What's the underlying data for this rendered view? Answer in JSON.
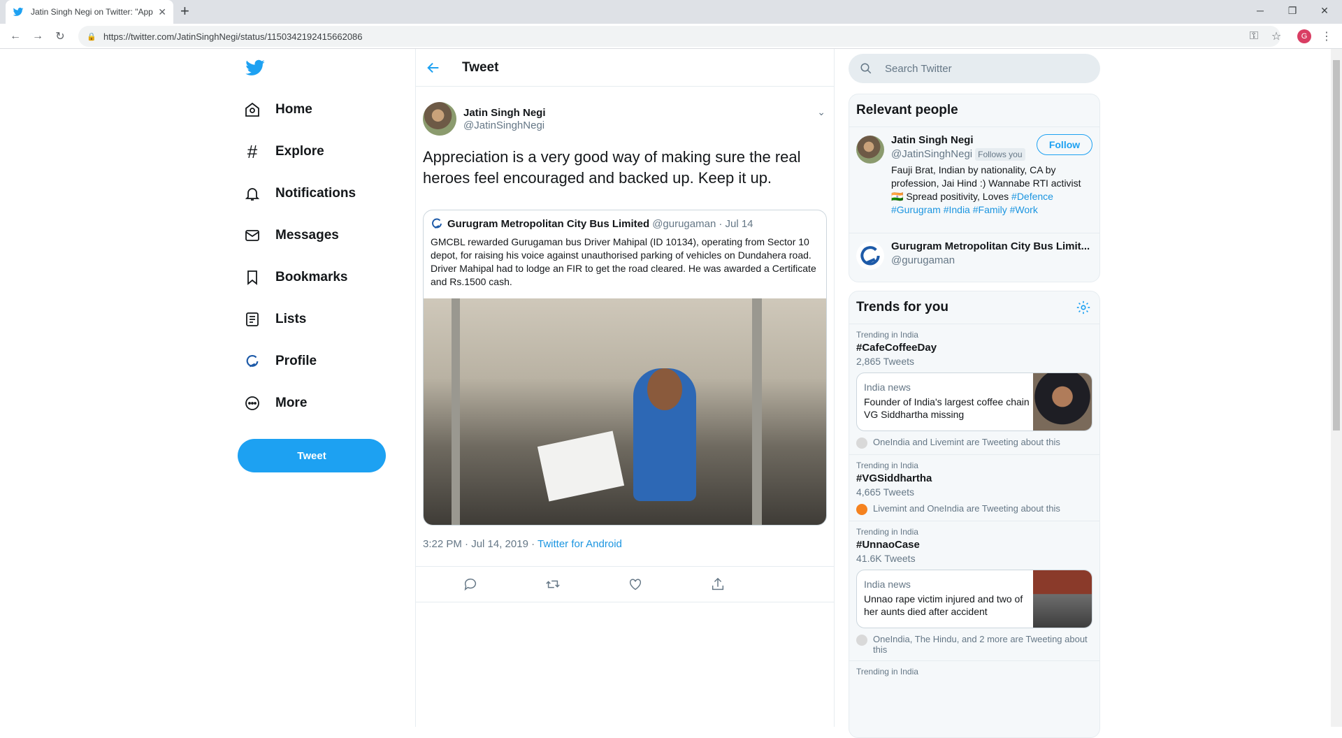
{
  "browser": {
    "tab_title": "Jatin Singh Negi on Twitter: \"App",
    "url": "https://twitter.com/JatinSinghNegi/status/1150342192415662086",
    "profile_initial": "G"
  },
  "sidebar": {
    "items": [
      {
        "label": "Home"
      },
      {
        "label": "Explore"
      },
      {
        "label": "Notifications"
      },
      {
        "label": "Messages"
      },
      {
        "label": "Bookmarks"
      },
      {
        "label": "Lists"
      },
      {
        "label": "Profile"
      },
      {
        "label": "More"
      }
    ],
    "tweet_button": "Tweet"
  },
  "main": {
    "header_title": "Tweet",
    "author_name": "Jatin Singh Negi",
    "author_handle": "@JatinSinghNegi",
    "text": "Appreciation is a very good way of making sure the real heroes feel encouraged and backed up. Keep it up.",
    "quote": {
      "name": "Gurugram Metropolitan City Bus Limited",
      "handle": "@gurugaman",
      "date": "· Jul 14",
      "text": "GMCBL rewarded Gurugaman bus Driver Mahipal (ID 10134), operating from Sector 10 depot, for raising his voice against unauthorised parking of vehicles on Dundahera road. Driver Mahipal had to lodge an FIR to get the road cleared. He was awarded a Certificate and Rs.1500 cash."
    },
    "timestamp": "3:22 PM · Jul 14, 2019 · ",
    "source": "Twitter for Android"
  },
  "right": {
    "search_placeholder": "Search Twitter",
    "relevant_title": "Relevant people",
    "people": [
      {
        "name": "Jatin Singh Negi",
        "handle": "@JatinSinghNegi",
        "follows_you": "Follows you",
        "follow_label": "Follow",
        "bio": "Fauji Brat, Indian by nationality, CA by profession, Jai Hind :) Wannabe RTI activist 🇮🇳 Spread positivity, Loves",
        "tags": "#Defence #Gurugram #India #Family #Work"
      },
      {
        "name": "Gurugram Metropolitan City Bus Limit...",
        "handle": "@gurugaman"
      }
    ],
    "trends_title": "Trends for you",
    "trends": [
      {
        "context": "Trending in India",
        "tag": "#CafeCoffeeDay",
        "count": "2,865 Tweets",
        "news_ctx": "India news",
        "news_title": "Founder of India's largest coffee chain VG Siddhartha missing",
        "tweeting": "OneIndia and Livemint are Tweeting about this"
      },
      {
        "context": "Trending in India",
        "tag": "#VGSiddhartha",
        "count": "4,665 Tweets",
        "tweeting": "Livemint and OneIndia are Tweeting about this"
      },
      {
        "context": "Trending in India",
        "tag": "#UnnaoCase",
        "count": "41.6K Tweets",
        "news_ctx": "India news",
        "news_title": "Unnao rape victim injured and two of her aunts died after accident",
        "tweeting": "OneIndia, The Hindu, and 2 more are Tweeting about this"
      },
      {
        "context": "Trending in India"
      }
    ]
  }
}
